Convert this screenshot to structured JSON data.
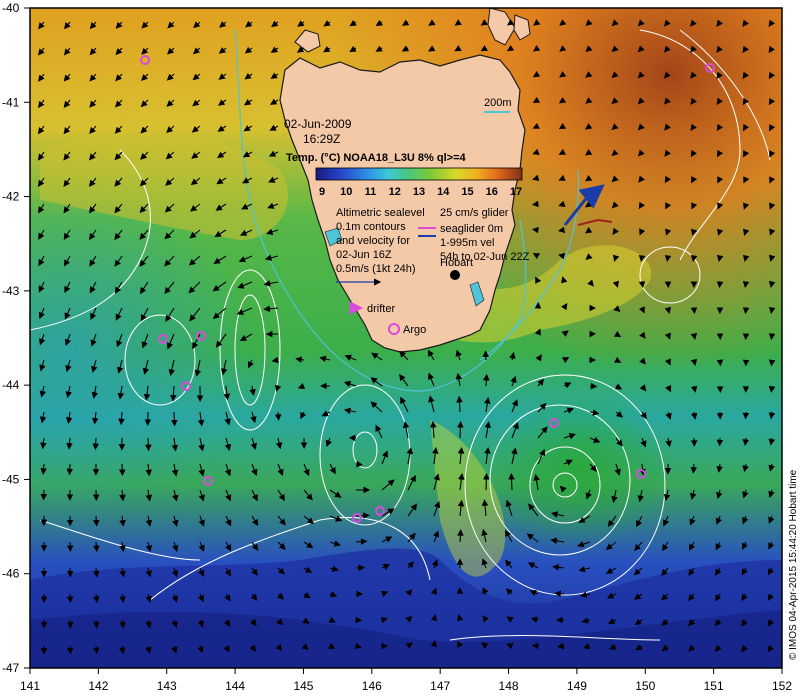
{
  "map": {
    "date": "02-Jun-2009",
    "time": "16:29Z",
    "colorbar_title": "Temp. (°C) NOAA18_L3U 8% ql>=4",
    "colorbar_ticks": [
      "9",
      "10",
      "11",
      "12",
      "13",
      "14",
      "15",
      "16",
      "17"
    ],
    "colorbar_colors": [
      "#1a1a80",
      "#2545c8",
      "#2d8fe6",
      "#3cc8d8",
      "#49c87a",
      "#35a838",
      "#7ac83a",
      "#d8d82a",
      "#f0b020",
      "#e06b1a",
      "#b5401a",
      "#803018"
    ],
    "legend_lines": [
      "Altimetric sealevel",
      "0.1m contours",
      "and velocity for",
      "02-Jun 16Z",
      "0.5m/s (1kt 24h)"
    ],
    "glider_lines": [
      "25 cm/s glider",
      "seaglider 0m",
      "1-995m vel",
      "54h to 02-Jun 22Z"
    ],
    "scale_label": "200m",
    "place_label": "Hobart",
    "drifter_label": "drifter",
    "argo_label": "Argo",
    "credit": "© IMOS 04-Apr-2015 15:44:20 Hobart time",
    "lon_ticks": [
      "141",
      "142",
      "143",
      "144",
      "145",
      "146",
      "147",
      "148",
      "149",
      "150",
      "151",
      "152"
    ],
    "lat_ticks": [
      "-40",
      "-41",
      "-42",
      "-43",
      "-44",
      "-45",
      "-46",
      "-47"
    ],
    "colors": {
      "land": "#f4c9a8",
      "contour": "#ffffff",
      "isobath": "#4fc3d8",
      "argo_marker": "#d94bd9",
      "glider_arrow": "#1a3ca8"
    }
  }
}
